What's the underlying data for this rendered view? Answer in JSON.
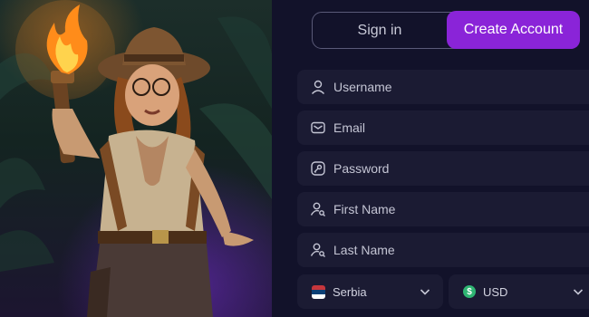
{
  "tabs": {
    "signin": "Sign in",
    "create": "Create Account"
  },
  "form": {
    "username": "Username",
    "email": "Email",
    "password": "Password",
    "first_name": "First Name",
    "last_name": "Last Name"
  },
  "selects": {
    "country": "Serbia",
    "currency": "USD"
  },
  "colors": {
    "accent": "#8a24d8",
    "field_bg": "#1b1b33",
    "panel_bg": "#12122a"
  }
}
